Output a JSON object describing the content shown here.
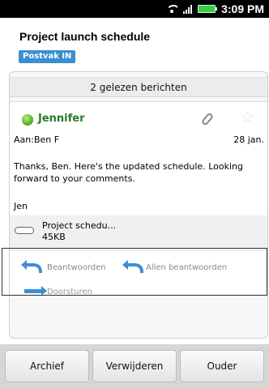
{
  "status_bar": {
    "time": "3:09 PM"
  },
  "header": {
    "subject": "Project launch schedule",
    "folder": "Postvak IN"
  },
  "thread": {
    "read_messages": "2 gelezen berichten"
  },
  "message": {
    "sender": "Jennifer",
    "to": "Aan:Ben F",
    "date": "28 jan.",
    "body": "Thanks, Ben. Here's the updated schedule. Looking forward to your comments.",
    "signature": "Jen",
    "attachment": {
      "name": "Project schedu...",
      "size": "45KB"
    }
  },
  "actions": {
    "reply": "Beantwoorden",
    "reply_all": "Allen beantwoorden",
    "forward": "Doorsturen"
  },
  "bottom_bar": {
    "archive": "Archief",
    "delete": "Verwijderen",
    "older": "Ouder"
  },
  "colors": {
    "accent": "#3a8fd6",
    "sender": "#2a7a26",
    "folder_badge": "#3b8fd0"
  }
}
